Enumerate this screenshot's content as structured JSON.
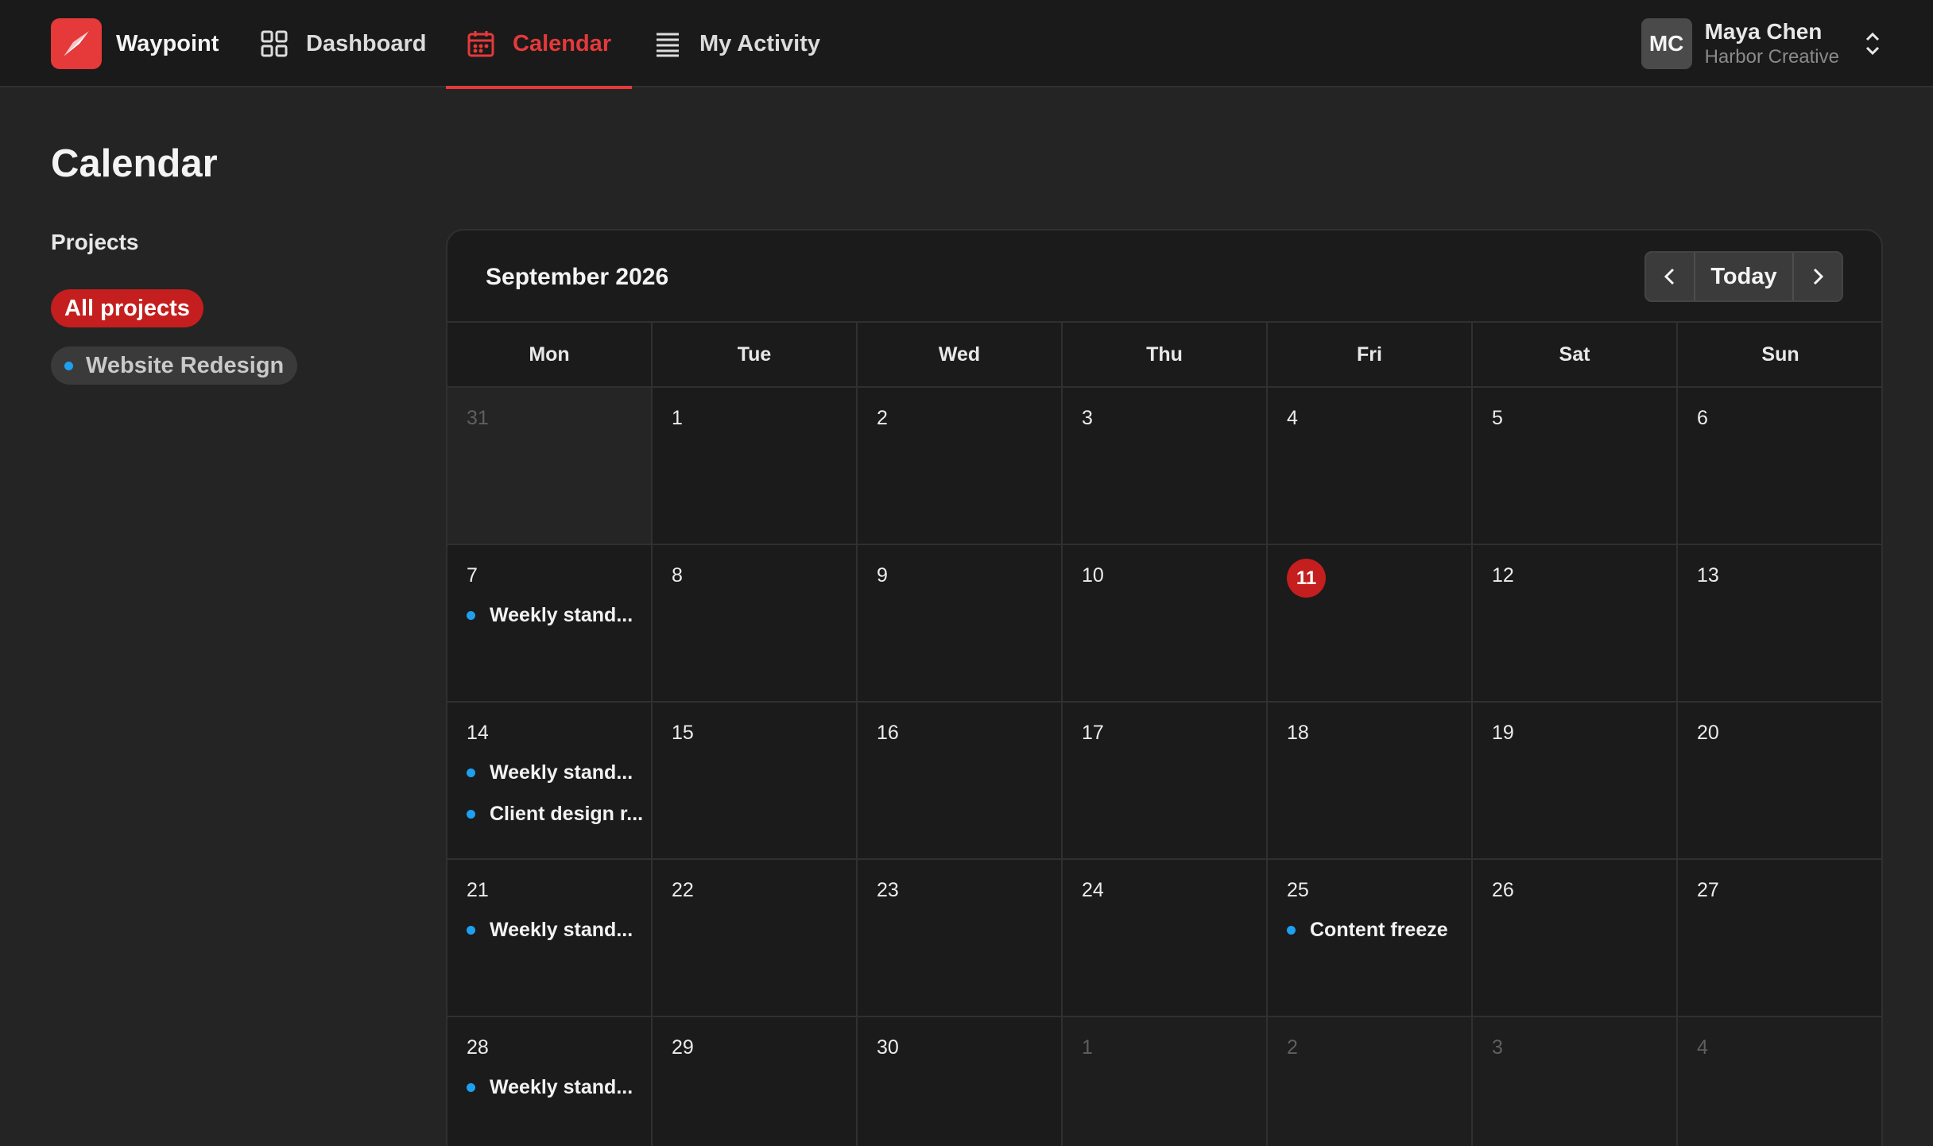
{
  "app": {
    "name": "Waypoint",
    "brand_color": "#e5393a"
  },
  "nav": {
    "tabs": [
      {
        "label": "Dashboard",
        "icon": "grid-icon",
        "active": false
      },
      {
        "label": "Calendar",
        "icon": "calendar-icon",
        "active": true
      },
      {
        "label": "My Activity",
        "icon": "list-icon",
        "active": false
      }
    ]
  },
  "user": {
    "initials": "MC",
    "name": "Maya Chen",
    "organization": "Harbor Creative"
  },
  "page": {
    "title": "Calendar"
  },
  "sidebar": {
    "heading": "Projects",
    "filters": [
      {
        "label": "All projects",
        "selected": true
      },
      {
        "label": "Website Redesign",
        "selected": false,
        "dot_color": "#1ea0f0"
      }
    ]
  },
  "calendar": {
    "month_label": "September 2026",
    "today_button": "Today",
    "weekdays": [
      "Mon",
      "Tue",
      "Wed",
      "Thu",
      "Fri",
      "Sat",
      "Sun"
    ],
    "today": 11,
    "weeks": [
      [
        {
          "d": "31",
          "outside": true
        },
        {
          "d": "1"
        },
        {
          "d": "2"
        },
        {
          "d": "3"
        },
        {
          "d": "4"
        },
        {
          "d": "5"
        },
        {
          "d": "6"
        }
      ],
      [
        {
          "d": "7",
          "events": [
            "Weekly stand..."
          ]
        },
        {
          "d": "8"
        },
        {
          "d": "9"
        },
        {
          "d": "10"
        },
        {
          "d": "11",
          "today": true
        },
        {
          "d": "12"
        },
        {
          "d": "13"
        }
      ],
      [
        {
          "d": "14",
          "events": [
            "Weekly stand...",
            "Client design r..."
          ]
        },
        {
          "d": "15"
        },
        {
          "d": "16"
        },
        {
          "d": "17"
        },
        {
          "d": "18"
        },
        {
          "d": "19"
        },
        {
          "d": "20"
        }
      ],
      [
        {
          "d": "21",
          "events": [
            "Weekly stand..."
          ]
        },
        {
          "d": "22"
        },
        {
          "d": "23"
        },
        {
          "d": "24"
        },
        {
          "d": "25",
          "events": [
            "Content freeze"
          ]
        },
        {
          "d": "26"
        },
        {
          "d": "27"
        }
      ],
      [
        {
          "d": "28",
          "events": [
            "Weekly stand..."
          ]
        },
        {
          "d": "29"
        },
        {
          "d": "30"
        },
        {
          "d": "1",
          "outside": true
        },
        {
          "d": "2",
          "outside": true
        },
        {
          "d": "3",
          "outside": true
        },
        {
          "d": "4",
          "outside": true
        }
      ]
    ],
    "event_dot_color": "#1ea0f0",
    "today_color": "#c41e1e"
  }
}
